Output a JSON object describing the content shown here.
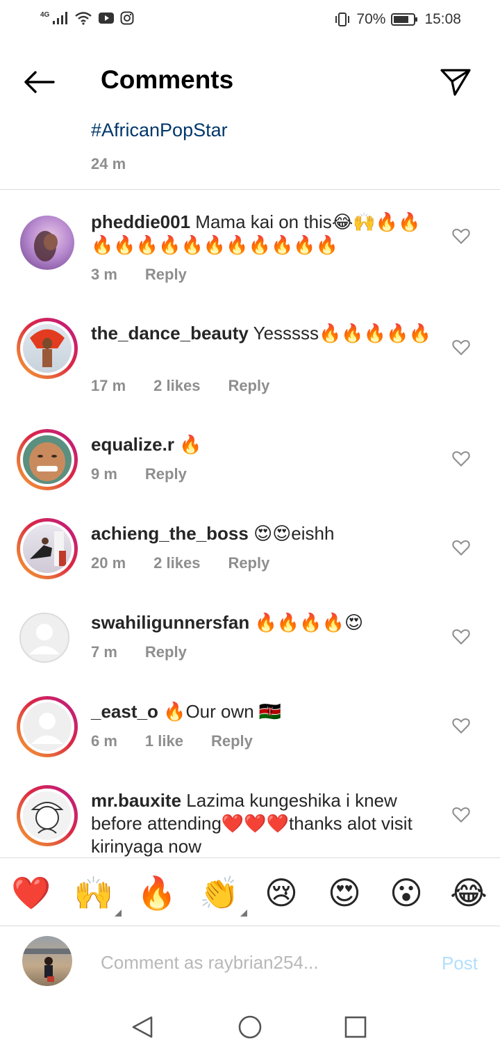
{
  "status_bar": {
    "network": "4G",
    "battery": "70%",
    "time": "15:08"
  },
  "header": {
    "title": "Comments"
  },
  "caption": {
    "hashtag": "#AfricanPopStar",
    "time": "24 m"
  },
  "comments": [
    {
      "username": "pheddie001",
      "text": "Mama kai on this😂🙌🔥🔥🔥🔥🔥🔥🔥🔥🔥🔥🔥🔥🔥",
      "time": "3 m",
      "likes": "",
      "reply": "Reply"
    },
    {
      "username": "the_dance_beauty",
      "text": "Yesssss🔥🔥🔥🔥🔥",
      "time": "17 m",
      "likes": "2 likes",
      "reply": "Reply"
    },
    {
      "username": "equalize.r",
      "text": "🔥",
      "time": "9 m",
      "likes": "",
      "reply": "Reply"
    },
    {
      "username": "achieng_the_boss",
      "text": "😍😍eishh",
      "time": "20 m",
      "likes": "2 likes",
      "reply": "Reply"
    },
    {
      "username": "swahiligunnersfan",
      "text": "🔥🔥🔥🔥😍",
      "time": "7 m",
      "likes": "",
      "reply": "Reply"
    },
    {
      "username": "_east_o",
      "text": "🔥Our own 🇰🇪",
      "time": "6 m",
      "likes": "1 like",
      "reply": "Reply"
    },
    {
      "username": "mr.bauxite",
      "text": "Lazima kungeshika i knew before attending❤️❤️❤️thanks alot visit kirinyaga now",
      "time": "",
      "likes": "",
      "reply": ""
    }
  ],
  "quick_reactions": [
    "❤️",
    "🙌",
    "🔥",
    "👏",
    "😢",
    "😍",
    "😮",
    "😂"
  ],
  "compose": {
    "placeholder": "Comment as raybrian254...",
    "post_label": "Post"
  },
  "colors": {
    "hashtag": "#00376b",
    "meta_gray": "#8e8e8e",
    "post_disabled": "#b2dffc",
    "story_ring_start": "#f9a030",
    "story_ring_end": "#bc1888"
  }
}
